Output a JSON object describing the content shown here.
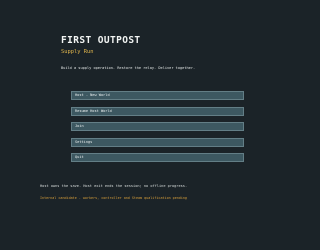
{
  "game": {
    "title": "FIRST OUTPOST",
    "subtitle": "Supply Run",
    "tagline": "Build a supply operation. Restore the relay. Deliver together."
  },
  "menu": {
    "items": [
      {
        "id": "host-new-world",
        "label": "Host - New World"
      },
      {
        "id": "resume-host-world",
        "label": "Resume Host World"
      },
      {
        "id": "join",
        "label": "Join"
      },
      {
        "id": "settings",
        "label": "Settings"
      },
      {
        "id": "quit",
        "label": "Quit"
      }
    ]
  },
  "footer": {
    "note": "Host owns the save. Host exit ends the session; no offline progress.",
    "status": "Internal candidate - workers, controller and Steam qualification pending"
  },
  "colors": {
    "background": "#1b2328",
    "title": "#f2f4f3",
    "subtitle": "#e0b54c",
    "button_fill": "#3d5861",
    "button_border": "#637e86",
    "status": "#d89f3a"
  }
}
